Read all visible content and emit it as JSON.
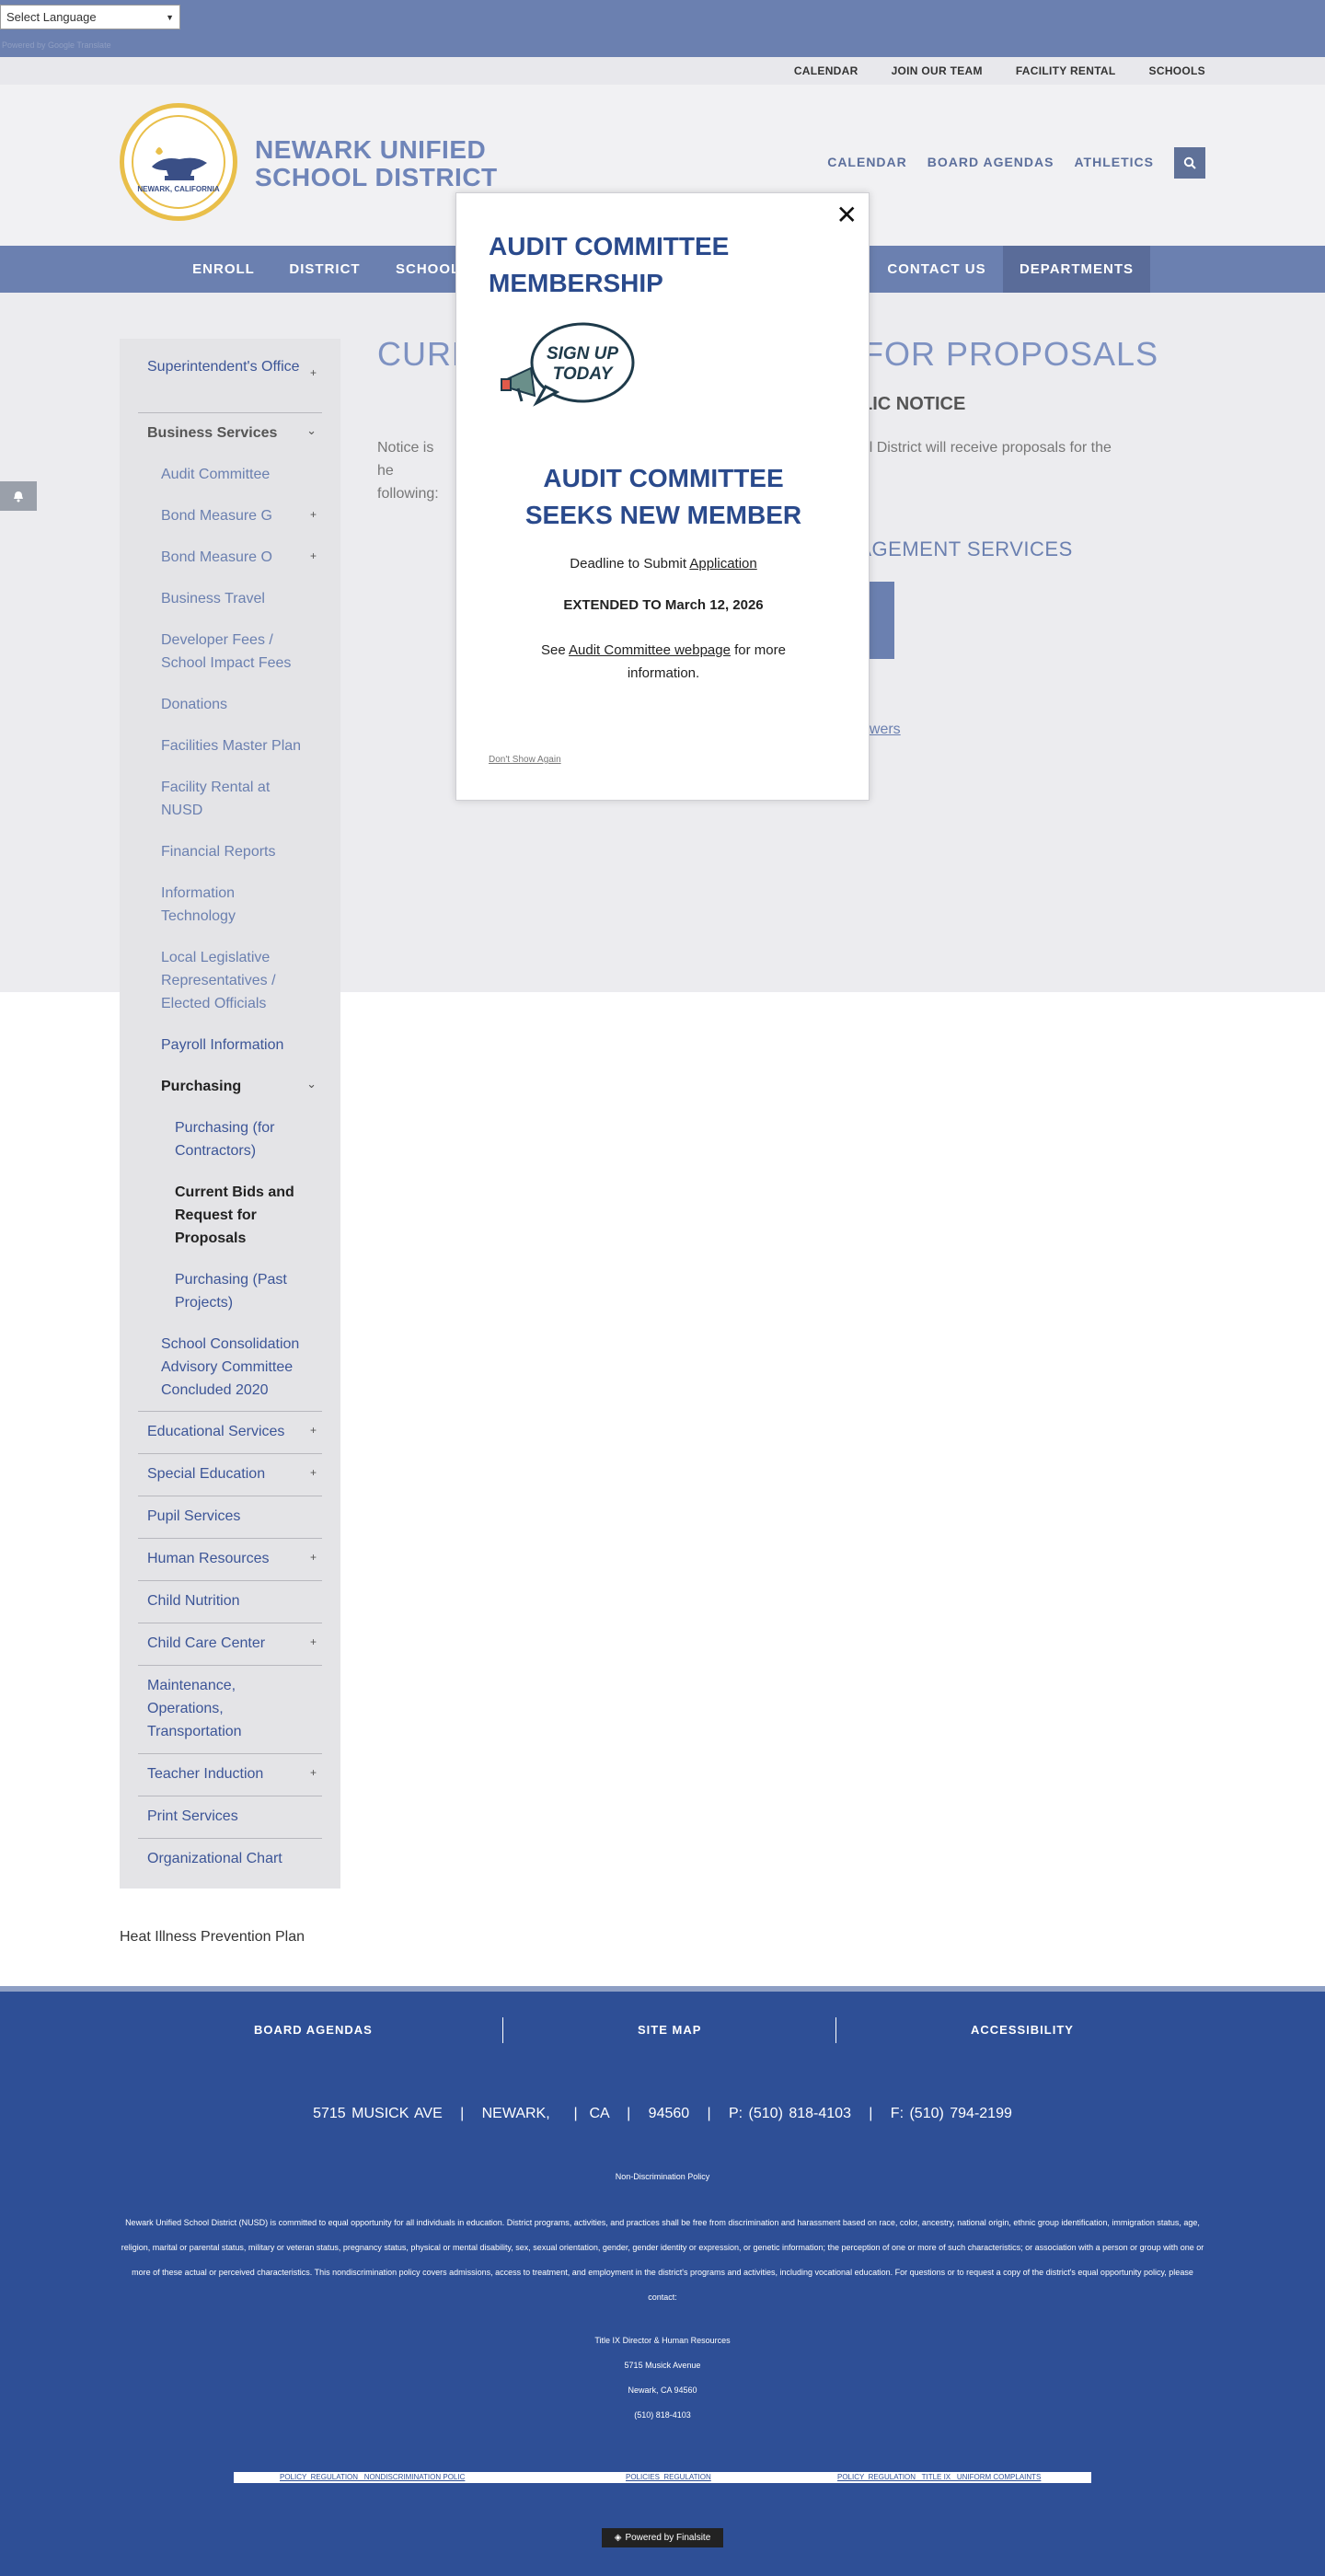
{
  "translate": {
    "select_label": "Select Language",
    "powered_by": "Powered by Google Translate"
  },
  "utility_nav": [
    "CALENDAR",
    "JOIN OUR TEAM",
    "FACILITY RENTAL",
    "SCHOOLS"
  ],
  "logo": {
    "name_line1": "NEWARK UNIFIED",
    "name_line2": "SCHOOL DISTRICT",
    "seal_text": "NEWARK, CALIFORNIA"
  },
  "header_nav": [
    "CALENDAR",
    "BOARD AGENDAS",
    "ATHLETICS"
  ],
  "main_nav": [
    "ENROLL",
    "DISTRICT",
    "SCHOOL",
    "CONTACT US",
    "DEPARTMENTS"
  ],
  "sidebar": {
    "superintendent": "Superintendent's Office",
    "business_services": "Business Services",
    "audit_committee": "Audit Committee",
    "bond_g": "Bond Measure G",
    "bond_o": "Bond Measure O",
    "business_travel": "Business Travel",
    "developer_fees": "Developer Fees / School Impact Fees",
    "donations": "Donations",
    "facilities_master": "Facilities Master Plan",
    "facility_rental": "Facility Rental at NUSD",
    "financial_reports": "Financial Reports",
    "info_tech": "Information Technology",
    "local_leg": "Local Legislative Representatives / Elected Officials",
    "payroll": "Payroll Information",
    "purchasing": "Purchasing",
    "purchasing_contractors": "Purchasing (for Contractors)",
    "current_bids": "Current Bids and Request for Proposals",
    "purchasing_past": "Purchasing (Past Projects)",
    "school_consolidation": "School Consolidation Advisory Committee Concluded 2020",
    "educational": "Educational Services",
    "special_ed": "Special Education",
    "pupil": "Pupil Services",
    "human_resources": "Human Resources",
    "child_nutrition": "Child Nutrition",
    "child_care": "Child Care Center",
    "maintenance": "Maintenance, Operations, Transportation",
    "teacher_induction": "Teacher Induction",
    "print_services": "Print Services",
    "org_chart": "Organizational Chart"
  },
  "page": {
    "title_left": "CURR",
    "title_right": "FOR PROPOSALS",
    "notice_heading": "LIC NOTICE",
    "notice_left": "Notice is he following:",
    "notice_right": "chool District will receive proposals for the",
    "section_heading": "NAGEMENT SERVICES",
    "answers_link": "nswers",
    "heat_link": "Heat Illness Prevention Plan"
  },
  "modal": {
    "close": "✕",
    "title": "AUDIT COMMITTEE MEMBERSHIP",
    "signup_line1": "SIGN UP",
    "signup_line2": "TODAY",
    "subtitle_line1": "AUDIT COMMITTEE",
    "subtitle_line2": "SEEKS NEW MEMBER",
    "deadline_prefix": "Deadline to Submit ",
    "deadline_link": "Application",
    "extended": "EXTENDED TO March 12, 2026",
    "see_prefix": "See ",
    "see_link": "Audit Committee webpage",
    "see_suffix": " for more information.",
    "dont_show": "Don't Show Again"
  },
  "footer": {
    "links": [
      "BOARD AGENDAS",
      "SITE MAP",
      "ACCESSIBILITY"
    ],
    "address": "5715 MUSICK AVE   |   NEWARK,    |  CA   |   94560   |   P: (510) 818-4103   |   F: (510) 794-2199",
    "nondiscrimination": "Non-Discrimination Policy",
    "policy_text": "Newark Unified School District (NUSD) is committed to equal opportunity for all individuals in education. District programs, activities, and practices shall be free from discrimination and harassment based on race, color, ancestry, national origin, ethnic group identification, immigration status, age, religion, marital or parental status, military or veteran status, pregnancy status, physical or mental disability, sex, sexual orientation, gender, gender identity or expression, or genetic information; the perception of one or more of such characteristics; or association with a person or group with one or more of these actual or perceived characteristics. This nondiscrimination policy covers admissions, access to treatment, and employment in the district's programs and activities, including vocational education. For questions or to request a copy of the district's equal opportunity policy, please contact:",
    "title_ix_line1": "Title IX Director & Human Resources",
    "title_ix_line2": "5715 Musick Avenue",
    "title_ix_line3": "Newark, CA 94560",
    "title_ix_line4": "(510) 818-4103",
    "policy_links": [
      "POLICY  REGULATION   NONDISCRIMINATION POLIC",
      "POLICIES  REGULATION",
      "POLICY  REGULATION   TITLE IX   UNIFORM COMPLAINTS"
    ],
    "powered": "Powered by Finalsite"
  }
}
